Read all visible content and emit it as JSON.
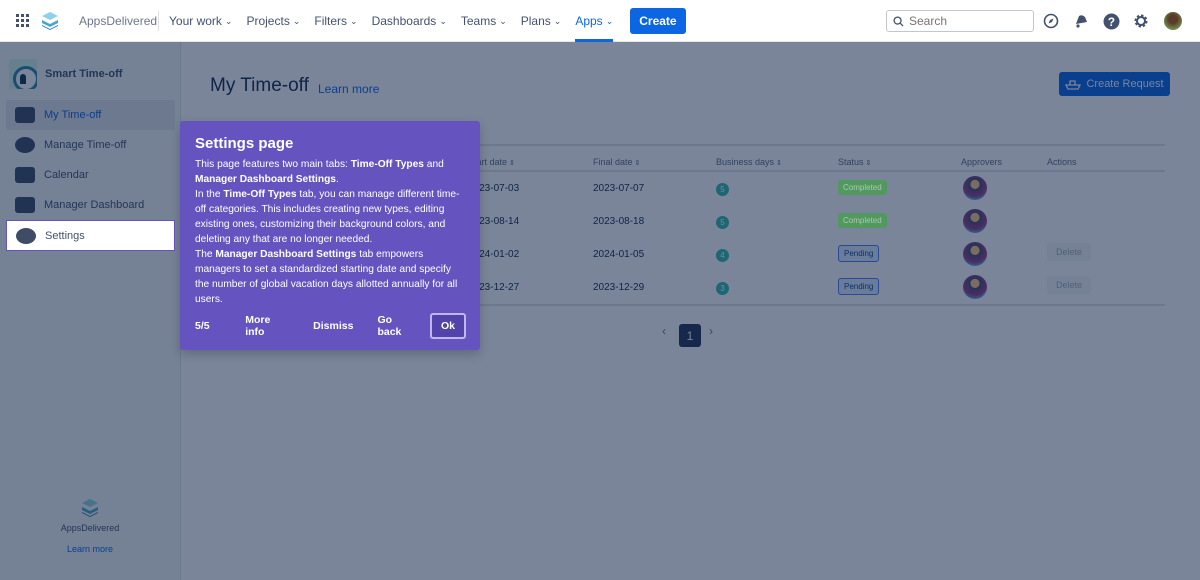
{
  "topnav": {
    "brand": "AppsDelivered",
    "menu": [
      {
        "label": "Your work"
      },
      {
        "label": "Projects"
      },
      {
        "label": "Filters"
      },
      {
        "label": "Dashboards"
      },
      {
        "label": "Teams"
      },
      {
        "label": "Plans"
      },
      {
        "label": "Apps",
        "active": true
      }
    ],
    "create_label": "Create",
    "search_placeholder": "Search",
    "icons": [
      "compass-icon",
      "bell-icon",
      "help-icon",
      "gear-icon"
    ]
  },
  "sidebar": {
    "app_name": "Smart Time-off",
    "items": [
      {
        "label": "My Time-off",
        "selected": true
      },
      {
        "label": "Manage Time-off"
      },
      {
        "label": "Calendar"
      },
      {
        "label": "Manager Dashboard"
      },
      {
        "label": "Settings",
        "highlighted": true
      }
    ],
    "footer_brand": "AppsDelivered",
    "footer_link": "Learn more"
  },
  "main": {
    "title": "My Time-off",
    "learn_more": "Learn more",
    "create_request": "Create Request",
    "columns": [
      "Start date",
      "Final date",
      "Business days",
      "Status",
      "Approvers",
      "Actions"
    ],
    "rows": [
      {
        "start": "2023-07-03",
        "final": "2023-07-07",
        "days": "5",
        "status": "Completed",
        "action": ""
      },
      {
        "start": "2023-08-14",
        "final": "2023-08-18",
        "days": "5",
        "status": "Completed",
        "action": ""
      },
      {
        "start": "2024-01-02",
        "final": "2024-01-05",
        "days": "4",
        "status": "Pending",
        "action": "Delete"
      },
      {
        "start": "2023-12-27",
        "final": "2023-12-29",
        "days": "3",
        "status": "Pending",
        "action": "Delete"
      }
    ],
    "pagination": {
      "current": "1"
    }
  },
  "tour": {
    "title": "Settings page",
    "body": [
      {
        "t": "This page features two main tabs: "
      },
      {
        "t": "Time-Off Types",
        "b": true
      },
      {
        "t": " and "
      },
      {
        "t": "Manager Dashboard Settings",
        "b": true
      },
      {
        "t": "."
      },
      {
        "br": true
      },
      {
        "t": "In the "
      },
      {
        "t": "Time-Off Types",
        "b": true
      },
      {
        "t": " tab, you can manage different time-off categories. This includes creating new types, editing existing ones, customizing their background colors, and deleting any that are no longer needed."
      },
      {
        "br": true
      },
      {
        "t": "The "
      },
      {
        "t": "Manager Dashboard Settings",
        "b": true
      },
      {
        "t": " tab empowers managers to set a standardized starting date and specify the number of global vacation days allotted annually for all users."
      }
    ],
    "step": "5/5",
    "more_info": "More info",
    "dismiss": "Dismiss",
    "go_back": "Go back",
    "ok": "Ok"
  },
  "colors": {
    "accent": "#0c66e4",
    "tour_bg": "#6554c0",
    "completed": "#36b37e",
    "overlay": "rgba(9,30,66,0.54)"
  }
}
